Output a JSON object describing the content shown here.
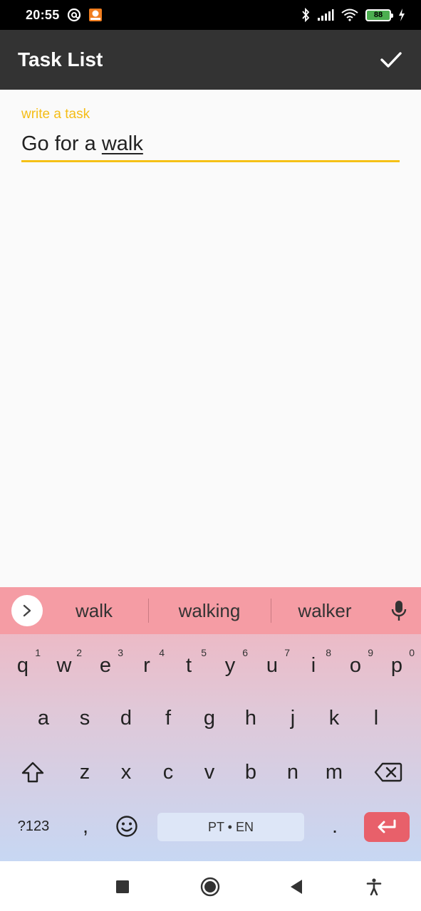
{
  "status_bar": {
    "time": "20:55",
    "battery": "88",
    "icons": [
      "at-sign-icon",
      "notification-app-icon",
      "bluetooth-icon",
      "signal-icon",
      "wifi-icon",
      "battery-icon",
      "charging-icon"
    ]
  },
  "app_bar": {
    "title": "Task List",
    "action_icon": "check-icon"
  },
  "form": {
    "label": "write a task",
    "value_prefix": "Go for a ",
    "value_composing": "walk",
    "accent_color": "#f5bd16"
  },
  "keyboard": {
    "suggestions": [
      "walk",
      "walking",
      "walker"
    ],
    "rows": [
      [
        {
          "label": "q",
          "hint": "1"
        },
        {
          "label": "w",
          "hint": "2"
        },
        {
          "label": "e",
          "hint": "3"
        },
        {
          "label": "r",
          "hint": "4"
        },
        {
          "label": "t",
          "hint": "5"
        },
        {
          "label": "y",
          "hint": "6"
        },
        {
          "label": "u",
          "hint": "7"
        },
        {
          "label": "i",
          "hint": "8"
        },
        {
          "label": "o",
          "hint": "9"
        },
        {
          "label": "p",
          "hint": "0"
        }
      ],
      [
        {
          "label": "a"
        },
        {
          "label": "s"
        },
        {
          "label": "d"
        },
        {
          "label": "f"
        },
        {
          "label": "g"
        },
        {
          "label": "h"
        },
        {
          "label": "j"
        },
        {
          "label": "k"
        },
        {
          "label": "l"
        }
      ],
      [
        {
          "label": "z"
        },
        {
          "label": "x"
        },
        {
          "label": "c"
        },
        {
          "label": "v"
        },
        {
          "label": "b"
        },
        {
          "label": "n"
        },
        {
          "label": "m"
        }
      ]
    ],
    "symbols_label": "?123",
    "comma_label": ",",
    "space_label": "PT • EN",
    "period_label": ".",
    "enter_color": "#e8606a"
  },
  "nav_bar": {
    "icons": [
      "recents-square-icon",
      "home-circle-icon",
      "back-triangle-icon",
      "accessibility-icon"
    ]
  }
}
